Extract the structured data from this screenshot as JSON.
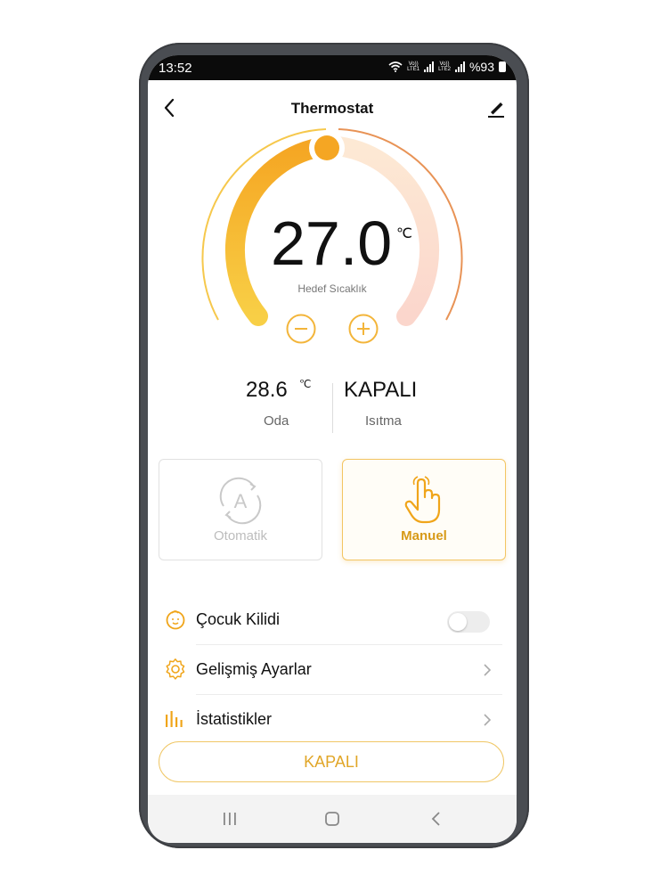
{
  "status": {
    "time": "13:52",
    "lte1": "Vo))\nLTE1",
    "lte2": "Vo))\nLTE2",
    "battery": "%93"
  },
  "header": {
    "title": "Thermostat"
  },
  "dial": {
    "target_temp": "27.0",
    "unit": "℃",
    "label": "Hedef Sıcaklık"
  },
  "stats": {
    "room_temp": "28.6",
    "room_unit": "℃",
    "room_label": "Oda",
    "heating_value": "KAPALI",
    "heating_label": "Isıtma"
  },
  "modes": [
    {
      "label": "Otomatik",
      "selected": false
    },
    {
      "label": "Manuel",
      "selected": true
    }
  ],
  "settings": [
    {
      "label": "Çocuk Kilidi",
      "icon": "child-face-icon",
      "control": "toggle",
      "on": false
    },
    {
      "label": "Gelişmiş Ayarlar",
      "icon": "gear-icon",
      "control": "chevron"
    },
    {
      "label": "İstatistikler",
      "icon": "bar-chart-icon",
      "control": "chevron"
    }
  ],
  "power_button": {
    "label": "KAPALI"
  },
  "colors": {
    "accent": "#f5a623",
    "accent_light": "#f3c563",
    "text_gold": "#e1a628"
  }
}
